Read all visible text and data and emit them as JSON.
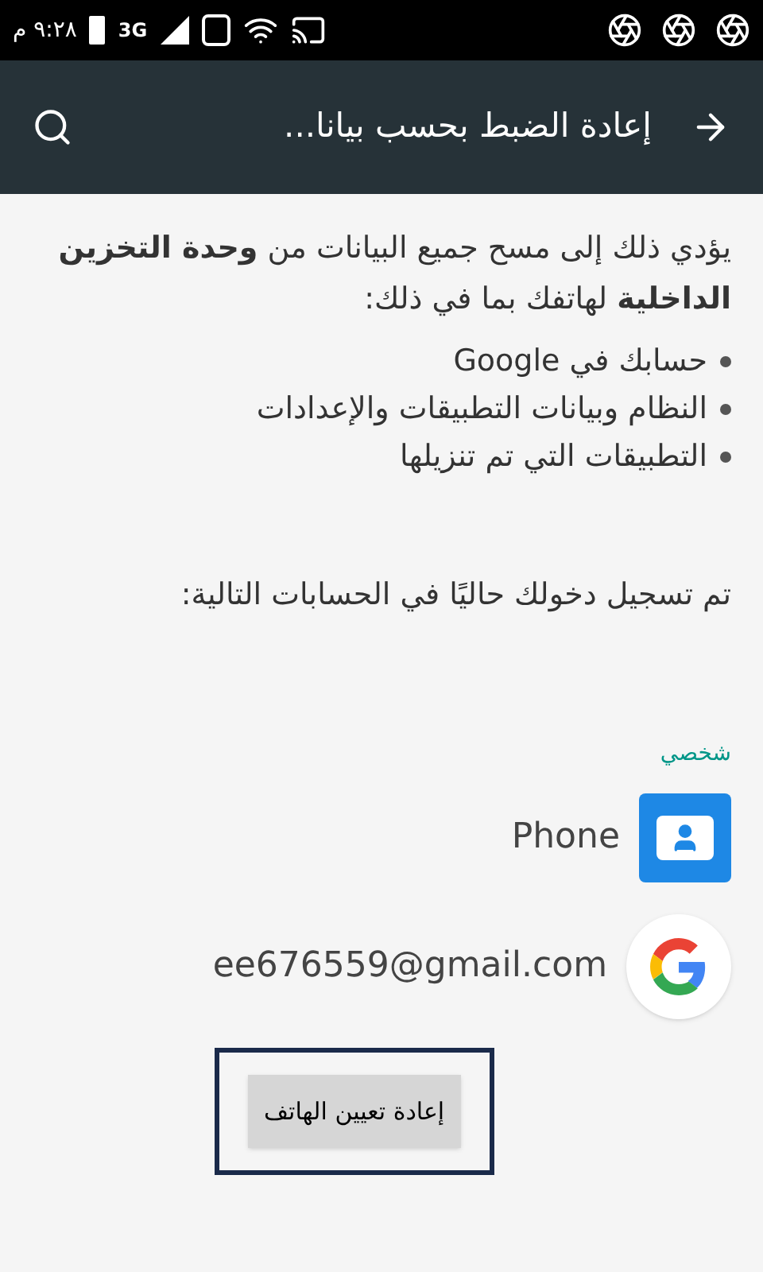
{
  "status_bar": {
    "time": "٩:٢٨ م",
    "network": "3G"
  },
  "toolbar": {
    "title": "إعادة الضبط بحسب بيانا..."
  },
  "intro": "يؤدي ذلك إلى مسح جميع البيانات من **وحدة التخزين الداخلية** لهاتفك بما في ذلك:",
  "bullets": [
    "حسابك في Google",
    "النظام وبيانات التطبيقات والإعدادات",
    "التطبيقات التي تم تنزيلها"
  ],
  "accounts_note": "تم تسجيل دخولك حاليًا في الحسابات التالية:",
  "section_label": "شخصي",
  "accounts": [
    {
      "kind": "phone",
      "name": "Phone"
    },
    {
      "kind": "google",
      "name": "ee676559@gmail.com"
    }
  ],
  "reset_button": {
    "label": "إعادة تعيين الهاتف",
    "highlighted": true
  }
}
